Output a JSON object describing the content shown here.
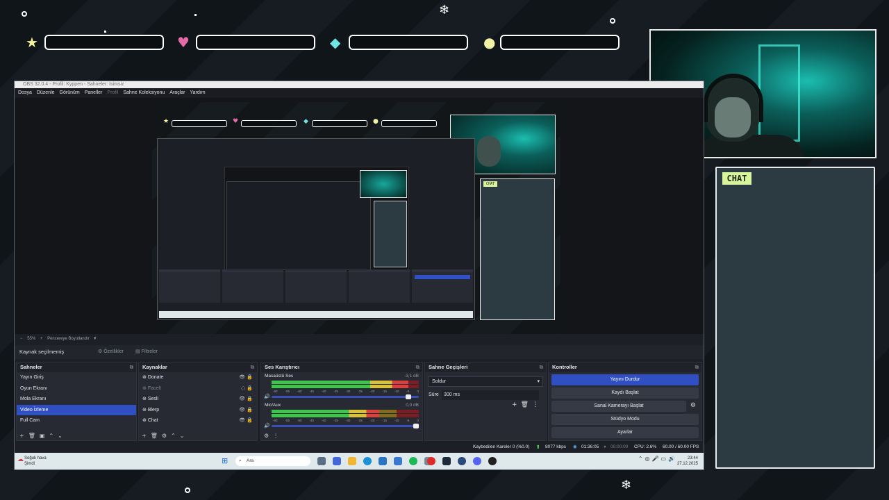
{
  "hud": {
    "icons": [
      "star-icon",
      "heart-icon",
      "diamond-icon",
      "coin-icon"
    ],
    "colors": [
      "#f5f29a",
      "#e36aa6",
      "#6fe3e3",
      "#f2f2a6"
    ]
  },
  "chat": {
    "label": "CHAT"
  },
  "obs": {
    "title": "OBS 32.0.4 - Profil: Kyppen - Sahneler: İsimsiz",
    "menu": [
      "Dosya",
      "Düzenle",
      "Görünüm",
      "Paneller",
      "Profil",
      "Sahne Koleksiyonu",
      "Araçlar",
      "Yardım"
    ],
    "zoom": "55%",
    "zoom_mode": "Pencereye Boyutlandır",
    "source_bar": {
      "none_selected": "Kaynak seçilmemiş",
      "properties": "Özellikler",
      "filters": "Filtreler"
    },
    "scenes": {
      "title": "Sahneler",
      "items": [
        "Yayın Giriş",
        "Oyun Ekranı",
        "Mola Ekranı",
        "Video İzleme",
        "Full Cam"
      ],
      "selected": "Video İzleme"
    },
    "sources": {
      "title": "Kaynaklar",
      "items": [
        "Donate",
        "Facelt",
        "Sesli",
        "Blerp",
        "Chat"
      ]
    },
    "mixer": {
      "title": "Ses Karıştırıcı",
      "channels": [
        {
          "name": "Masaüstü Ses",
          "db": "-3,1 dB",
          "level": 0.93,
          "volume": 0.95
        },
        {
          "name": "Mic/Aux",
          "db": "0,0 dB",
          "level": 0.73,
          "volume": 1.0
        }
      ],
      "ticks": [
        "-60",
        "-55",
        "-50",
        "-45",
        "-40",
        "-35",
        "-30",
        "-25",
        "-20",
        "-15",
        "-10",
        "-5",
        "0"
      ]
    },
    "transitions": {
      "title": "Sahne Geçişleri",
      "type": "Soldur",
      "duration_label": "Süre",
      "duration_value": "300 ms"
    },
    "controls": {
      "title": "Kontroller",
      "buttons": [
        "Yayını Durdur",
        "Kaydı Başlat",
        "Sanal Kamerayı Başlat",
        "Stüdyo Modu",
        "Ayarlar"
      ]
    },
    "status": {
      "dropped": "Kaybedilen Kareler 0 (%0.0)",
      "bitrate": "8077 kbps",
      "stream_time": "01:36:05",
      "rec_time": "00:00:00",
      "cpu": "CPU: 2.6%",
      "fps": "60.00 / 60.00 FPS"
    }
  },
  "taskbar": {
    "weather_title": "Soğuk hava",
    "weather_sub": "Şimdi",
    "search": "Ara",
    "time": "23:44",
    "date": "27.12.2025"
  }
}
